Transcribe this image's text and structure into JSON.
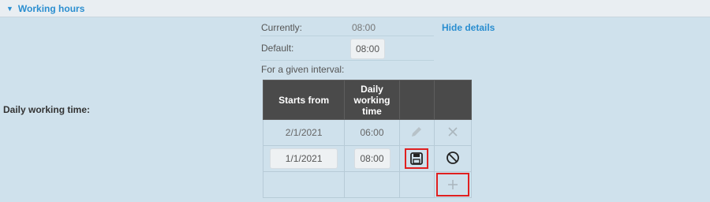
{
  "section": {
    "title": "Working hours",
    "caret_icon": "caret-down-icon"
  },
  "row_label": "Daily working time:",
  "details": {
    "currently_label": "Currently:",
    "currently_value": "08:00",
    "hide_link": "Hide details",
    "default_label": "Default:",
    "default_value": "08:00",
    "interval_label": "For a given interval:"
  },
  "table": {
    "headers": [
      "Starts from",
      "Daily working time",
      "",
      ""
    ],
    "rows": [
      {
        "start": "2/1/2021",
        "hours": "06:00",
        "edit_icon": "pencil-icon",
        "delete_icon": "close-icon"
      },
      {
        "start": "1/1/2021",
        "hours": "08:00",
        "save_icon": "floppy-disk-icon",
        "cancel_icon": "cancel-circle-icon"
      }
    ],
    "add_icon": "plus-icon"
  },
  "colors": {
    "accent": "#2a8ed0",
    "highlight": "#e02020",
    "header_bg": "#4a4a4a",
    "panel_bg": "#cfe1ec"
  }
}
